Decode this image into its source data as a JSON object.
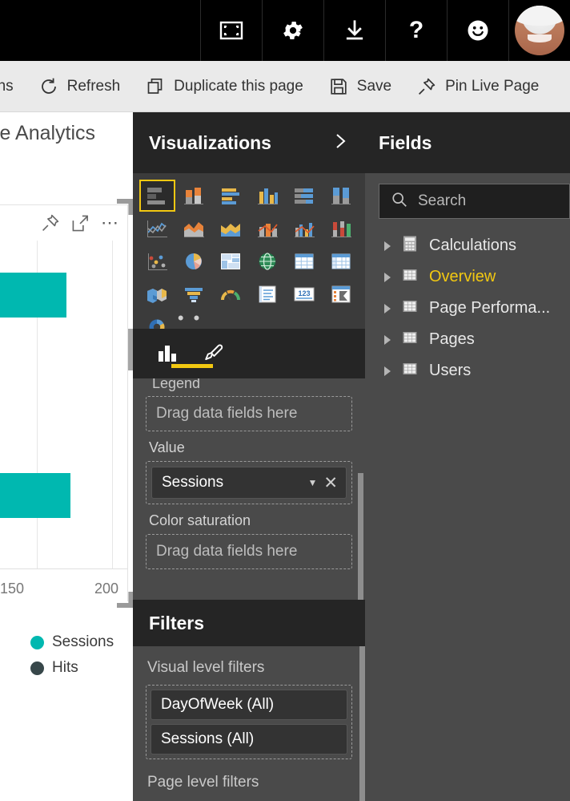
{
  "topbar": {
    "buttons": [
      {
        "name": "fullscreen-icon",
        "label": "Full screen"
      },
      {
        "name": "gear-icon",
        "label": "Settings"
      },
      {
        "name": "download-icon",
        "label": "Download"
      },
      {
        "name": "help-icon",
        "label": "Help",
        "glyph": "?"
      },
      {
        "name": "smiley-icon",
        "label": "Feedback"
      }
    ],
    "avatar_label": "Account"
  },
  "toolbar": {
    "items": [
      {
        "label": "ons",
        "icon": "none",
        "truncated": true
      },
      {
        "label": "Refresh",
        "icon": "refresh-icon"
      },
      {
        "label": "Duplicate this page",
        "icon": "duplicate-icon"
      },
      {
        "label": "Save",
        "icon": "save-icon"
      },
      {
        "label": "Pin Live Page",
        "icon": "pin-icon"
      }
    ]
  },
  "canvas": {
    "report_title": "le Analytics",
    "visual_header_icons": [
      "pin-icon",
      "focus-mode-icon",
      "more-options-icon"
    ]
  },
  "chart_data": {
    "type": "bar",
    "orientation": "horizontal",
    "title": "",
    "xlabel": "",
    "ylabel": "",
    "categories": [
      "",
      ""
    ],
    "series": [
      {
        "name": "Sessions",
        "color": "#00b8b0",
        "values": [
          166,
          174
        ]
      }
    ],
    "legend": [
      {
        "label": "Sessions",
        "color": "#00b8b0"
      },
      {
        "label": "Hits",
        "color": "#37474a"
      }
    ],
    "xticks": [
      "150",
      "200"
    ],
    "xlim": [
      100,
      215
    ],
    "grid": true,
    "legend_position": "bottom"
  },
  "visualizations": {
    "title": "Visualizations",
    "expand_label": "Expand",
    "icons": [
      {
        "name": "stacked-bar-chart-icon",
        "selected": true
      },
      {
        "name": "stacked-column-chart-icon",
        "selected": false
      },
      {
        "name": "clustered-bar-chart-icon",
        "selected": false
      },
      {
        "name": "clustered-column-chart-icon",
        "selected": false
      },
      {
        "name": "hundred-percent-stacked-bar-chart-icon",
        "selected": false
      },
      {
        "name": "hundred-percent-stacked-column-chart-icon",
        "selected": false
      },
      {
        "name": "line-chart-icon",
        "selected": false
      },
      {
        "name": "area-chart-icon",
        "selected": false
      },
      {
        "name": "stacked-area-chart-icon",
        "selected": false
      },
      {
        "name": "line-stacked-column-chart-icon",
        "selected": false
      },
      {
        "name": "line-clustered-column-chart-icon",
        "selected": false
      },
      {
        "name": "ribbon-chart-icon",
        "selected": false
      },
      {
        "name": "scatter-chart-icon",
        "selected": false
      },
      {
        "name": "pie-chart-icon",
        "selected": false
      },
      {
        "name": "treemap-icon",
        "selected": false
      },
      {
        "name": "map-icon",
        "selected": false
      },
      {
        "name": "table-icon",
        "selected": false
      },
      {
        "name": "matrix-icon",
        "selected": false
      },
      {
        "name": "filled-map-icon",
        "selected": false
      },
      {
        "name": "funnel-chart-icon",
        "selected": false
      },
      {
        "name": "gauge-icon",
        "selected": false
      },
      {
        "name": "multi-row-card-icon",
        "selected": false
      },
      {
        "name": "card-icon",
        "selected": false
      },
      {
        "name": "kpi-icon",
        "selected": false
      },
      {
        "name": "donut-chart-icon",
        "selected": false
      },
      {
        "name": "more-visuals-icon",
        "selected": false,
        "glyph": "• • •"
      }
    ],
    "tabs": [
      {
        "name": "fields-tab",
        "icon": "bar-chart-icon",
        "active": true
      },
      {
        "name": "format-tab",
        "icon": "paintbrush-icon",
        "active": false
      }
    ],
    "wells": [
      {
        "label": "Legend",
        "placeholder": "Drag data fields here",
        "field": null
      },
      {
        "label": "Value",
        "placeholder": "",
        "field": "Sessions"
      },
      {
        "label": "Color saturation",
        "placeholder": "Drag data fields here",
        "field": null
      }
    ]
  },
  "filters": {
    "title": "Filters",
    "sections": [
      {
        "label": "Visual level filters",
        "items": [
          "DayOfWeek (All)",
          "Sessions (All)"
        ]
      },
      {
        "label": "Page level filters",
        "items": []
      }
    ]
  },
  "fields": {
    "title": "Fields",
    "search": {
      "placeholder": "Search",
      "value": ""
    },
    "tables": [
      {
        "label": "Calculations",
        "icon": "calculator-icon",
        "active": false
      },
      {
        "label": "Overview",
        "icon": "table-icon",
        "active": true
      },
      {
        "label": "Page Performa...",
        "icon": "table-icon",
        "active": false
      },
      {
        "label": "Pages",
        "icon": "table-icon",
        "active": false
      },
      {
        "label": "Users",
        "icon": "table-icon",
        "active": false
      }
    ]
  },
  "colors": {
    "accent_yellow": "#f2c811",
    "series_teal": "#00b8b0",
    "series_dark": "#37474a",
    "panel_bg": "#4a4a4a",
    "panel_head_bg": "#252525",
    "viz_grid_bg": "#3b3b3b"
  }
}
